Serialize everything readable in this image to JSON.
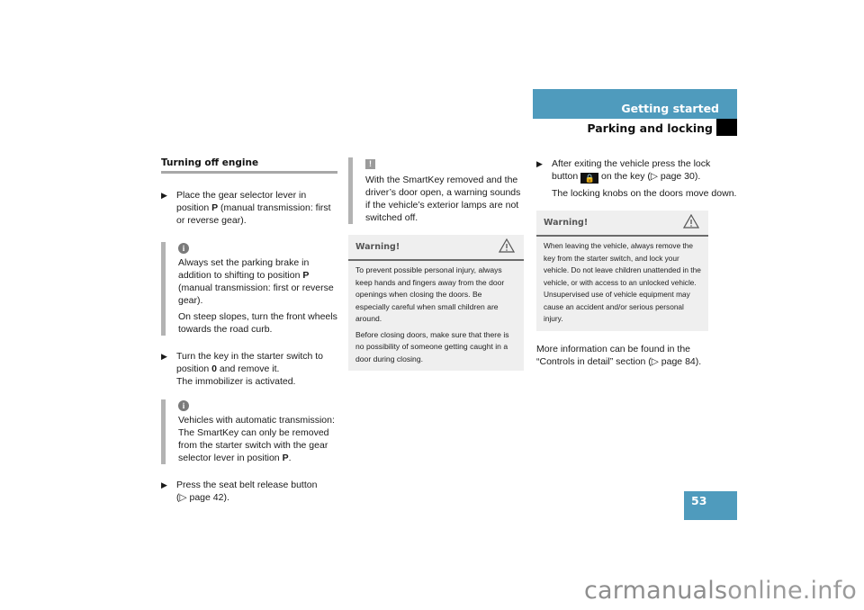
{
  "header": {
    "section": "Getting started",
    "subsection": "Parking and locking"
  },
  "page_number": "53",
  "column1": {
    "title": "Turning off engine",
    "step1": {
      "pre": "Place the gear selector lever in position ",
      "bold": "P",
      "post": " (manual transmission: first or reverse gear)."
    },
    "note1": {
      "icon": "info-icon",
      "p1_pre": "Always set the parking brake in addition to shifting to position ",
      "p1_bold": "P",
      "p1_post": " (manual transmission: first or reverse gear).",
      "p2": "On steep slopes, turn the front wheels towards the road curb."
    },
    "step2": {
      "pre": "Turn the key in the starter switch to position ",
      "bold": "0",
      "post": " and remove it.",
      "line2": "The immobilizer is activated."
    },
    "note2": {
      "icon": "info-icon",
      "p1_pre": "Vehicles with automatic transmission: The SmartKey can only be removed from the starter switch with the gear selector lever in position ",
      "p1_bold": "P",
      "p1_post": "."
    },
    "step3": {
      "text": "Press the seat belt release button",
      "ref": "(▷ page 42)."
    }
  },
  "column2": {
    "note": {
      "icon": "exclamation-icon",
      "glyph": "!",
      "text": "With the SmartKey removed and the driver’s door open, a warning sounds if the vehicle’s exterior lamps are not switched off."
    },
    "warning": {
      "title": "Warning!",
      "p1": "To prevent possible personal injury, always keep hands and fingers away from the door openings when closing the doors. Be especially careful when small children are around.",
      "p2": "Before closing doors, make sure that there is no possibility of someone getting caught in a door during closing."
    }
  },
  "column3": {
    "step": {
      "pre": "After exiting the vehicle press the lock button ",
      "post": " on the key (▷ page 30).",
      "line2": "The locking knobs on the doors move down."
    },
    "warning": {
      "title": "Warning!",
      "p1": "When leaving the vehicle, always remove the key from the starter switch, and lock your vehicle. Do not leave children unattended in the vehicle, or with access to an unlocked vehicle. Unsupervised use of vehicle equipment may cause an accident and/or serious personal injury."
    },
    "more_info": "More information can be found in the “Controls in detail” section (▷ page 84)."
  },
  "watermark": {
    "part1": "carmanuals",
    "part2": "online.info"
  },
  "colors": {
    "accent": "#4f9bbd",
    "note_bar": "#b3b3b3",
    "warning_bg": "#efefef"
  }
}
